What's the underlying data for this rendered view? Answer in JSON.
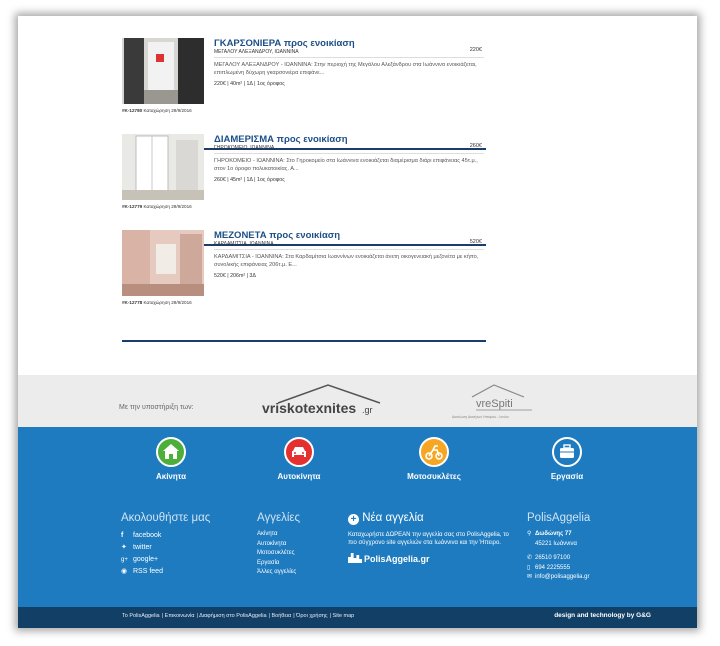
{
  "listings": [
    {
      "title": "ΓΚΑΡΣΟΝΙΕΡΑ προς ενοικίαση",
      "location": "ΜΕΓΑΛΟΥ ΑΛΕΞΑΝΔΡΟΥ, ΙΩΑΝΝΙΝΑ",
      "price": "220€",
      "description": "ΜΕΓΑΛΟΥ ΑΛΕΞΑΝΔΡΟΥ - ΙΩΑΝΝΙΝΑ: Στην περιοχή της Μεγάλου Αλεξάνδρου στα Ιωάννινα ενοικιάζεται, επιπλωμένη δύχωρη γκαρσονιέρα επιφάνε...",
      "specs": "220€ | 40m² | 1Δ | 1ος όροφος",
      "id": "#K-12780",
      "registered": "Καταχώρηση 29/9/2016"
    },
    {
      "title": "ΔΙΑΜΕΡΙΣΜΑ προς ενοικίαση",
      "location": "ΓΗΡΟΚΟΜΕΙΟ, ΙΩΑΝΝΙΝΑ",
      "price": "260€",
      "description": "ΓΗΡΟΚΟΜΕΙΟ - ΙΩΑΝΝΙΝΑ: Στο Γηροκομείο στα Ιωάννινα ενοικιάζεται διαμέρισμα διάρι επιφάνειας 45τ.μ., στον 1ο όροφο πολυκατοικίας. Α...",
      "specs": "260€ | 45m² | 1Δ | 1ος όροφος",
      "id": "#K-12779",
      "registered": "Καταχώρηση 29/9/2016"
    },
    {
      "title": "ΜΕΖΟΝΕΤΑ προς ενοικίαση",
      "location": "ΚΑΡΔΑΜΙΤΣΙΑ, ΙΩΑΝΝΙΝΑ",
      "price": "520€",
      "description": "ΚΑΡΔΑΜΙΤΣΙΑ - ΙΩΑΝΝΙΝΑ: Στα Καρδαμίτσια Ιωαννίνων ενοικιάζεται άνετη οικογενειακή μεζονέτα με κήπο, συνολικής επιφάνειας 206τ.μ. Ε...",
      "specs": "520€ | 206m² | 3Δ",
      "id": "#K-12778",
      "registered": "Καταχώρηση 29/9/2016"
    }
  ],
  "sponsors": {
    "label": "Με την υποστήριξη των:",
    "logo1_text": "vriskotexnites",
    "logo1_suffix": ".gr",
    "logo2_text": "vreSpiti",
    "logo2_sub": "Δικτύωση Ακινήτων Ηπείρου - Ιονίου"
  },
  "categories": [
    {
      "label": "Ακίνητα",
      "color": "#4caf3a",
      "icon": "house-icon"
    },
    {
      "label": "Αυτοκίνητα",
      "color": "#e53030",
      "icon": "car-icon"
    },
    {
      "label": "Μοτοσυκλέτες",
      "color": "#f5a623",
      "icon": "motorcycle-icon"
    },
    {
      "label": "Εργασία",
      "color": "#1e7bbf",
      "icon": "briefcase-icon"
    }
  ],
  "follow": {
    "heading": "Ακολουθήστε μας",
    "items": [
      {
        "icon": "facebook-icon",
        "glyph": "f",
        "label": "facebook"
      },
      {
        "icon": "twitter-icon",
        "glyph": "🐦",
        "label": "twitter"
      },
      {
        "icon": "googleplus-icon",
        "glyph": "g+",
        "label": "google+"
      },
      {
        "icon": "rss-icon",
        "glyph": "◉",
        "label": "RSS feed"
      }
    ]
  },
  "ads": {
    "heading": "Αγγελίες",
    "items": [
      "Ακίνητα",
      "Αυτοκίνητα",
      "Μοτοσυκλέτες",
      "Εργασία",
      "Άλλες αγγελίες"
    ]
  },
  "new_ad": {
    "heading": "Νέα αγγελία",
    "text": "Καταχωρήστε ΔΩΡΕΑΝ την αγγελία σας στο PolisAggelia, το πιο σύγχρονο site αγγελιών στα Ιωάννινα και την Ήπειρο.",
    "logo": "PolisAggelia.gr"
  },
  "contact": {
    "heading": "PolisAggelia",
    "street": "Δωδώνης 77",
    "city": "45221 Ιωάννινα",
    "phone1": "26510 97100",
    "phone2": "694 2225555",
    "email": "info@polisaggelia.gr"
  },
  "footer": {
    "links": [
      "Το PolisAggelia",
      "Επικοινωνία",
      "Διαφήμιση στο PolisAggelia",
      "Βοήθεια",
      "Όροι χρήσης",
      "Site map"
    ],
    "design": "design and technology by G&G"
  }
}
